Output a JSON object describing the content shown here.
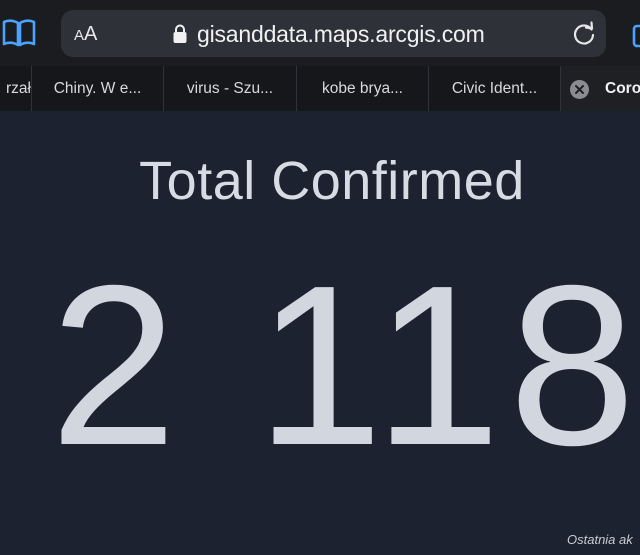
{
  "browser": {
    "aa_small": "A",
    "aa_big": "A",
    "url": "gisanddata.maps.arcgis.com",
    "icons": {
      "bookmarks": "book-icon",
      "lock": "lock-icon",
      "reload": "reload-icon",
      "tabs": "tabs-icon",
      "close": "close-icon"
    }
  },
  "tabs": [
    {
      "label": "rzał"
    },
    {
      "label": "Chiny. W e..."
    },
    {
      "label": "virus - Szu..."
    },
    {
      "label": "kobe brya..."
    },
    {
      "label": "Civic Ident..."
    },
    {
      "label": "Coro",
      "active": true
    }
  ],
  "main": {
    "heading": "Total Confirmed",
    "value": "2 118",
    "footer": "Ostatnia ak"
  },
  "colors": {
    "background": "#1c2230",
    "text": "#d1d6df"
  }
}
